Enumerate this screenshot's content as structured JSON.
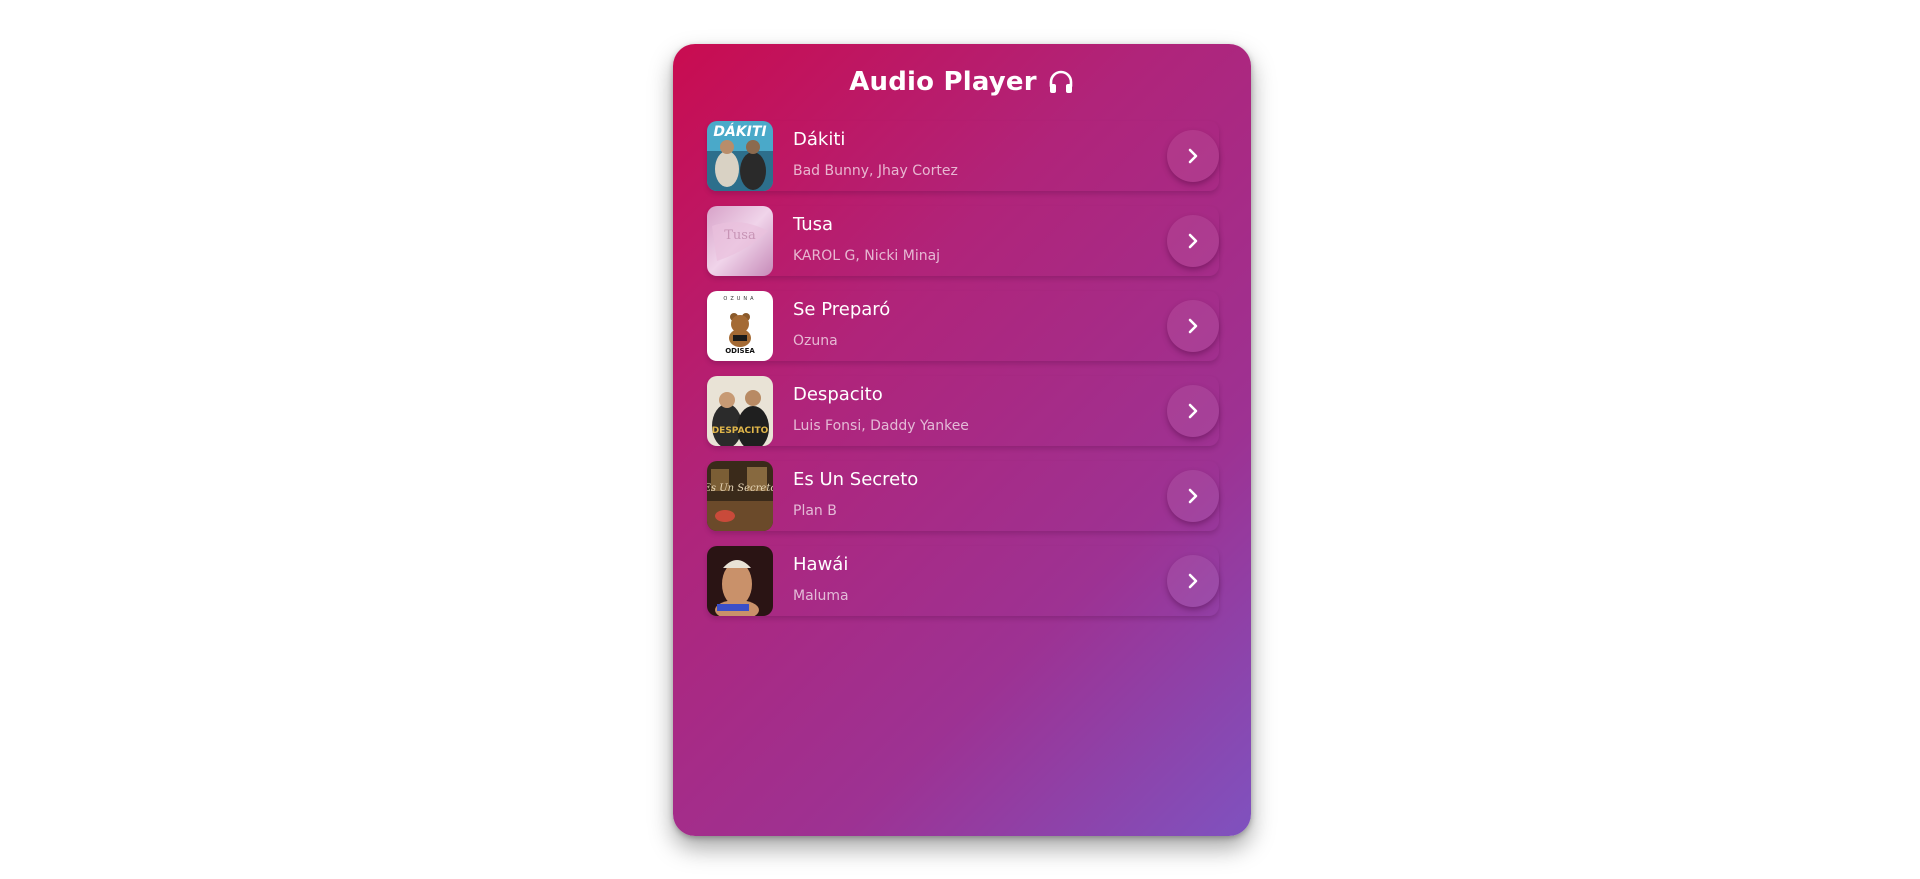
{
  "header": {
    "title": "Audio Player",
    "icon": "headphones-icon"
  },
  "colors": {
    "gradient_start": "#c90c50",
    "gradient_end": "#7f52bf",
    "text": "#ffffff"
  },
  "tracks": [
    {
      "title": "Dákiti",
      "artist": "Bad Bunny, Jhay Cortez",
      "cover": "album-cover-dakiti",
      "action_icon": "chevron-right-icon"
    },
    {
      "title": "Tusa",
      "artist": "KAROL G, Nicki Minaj",
      "cover": "album-cover-tusa",
      "action_icon": "chevron-right-icon"
    },
    {
      "title": "Se Preparó",
      "artist": "Ozuna",
      "cover": "album-cover-se-preparo",
      "action_icon": "chevron-right-icon"
    },
    {
      "title": "Despacito",
      "artist": "Luis Fonsi, Daddy Yankee",
      "cover": "album-cover-despacito",
      "action_icon": "chevron-right-icon"
    },
    {
      "title": "Es Un Secreto",
      "artist": "Plan B",
      "cover": "album-cover-es-un-secreto",
      "action_icon": "chevron-right-icon"
    },
    {
      "title": "Hawái",
      "artist": "Maluma",
      "cover": "album-cover-hawai",
      "action_icon": "chevron-right-icon"
    }
  ]
}
